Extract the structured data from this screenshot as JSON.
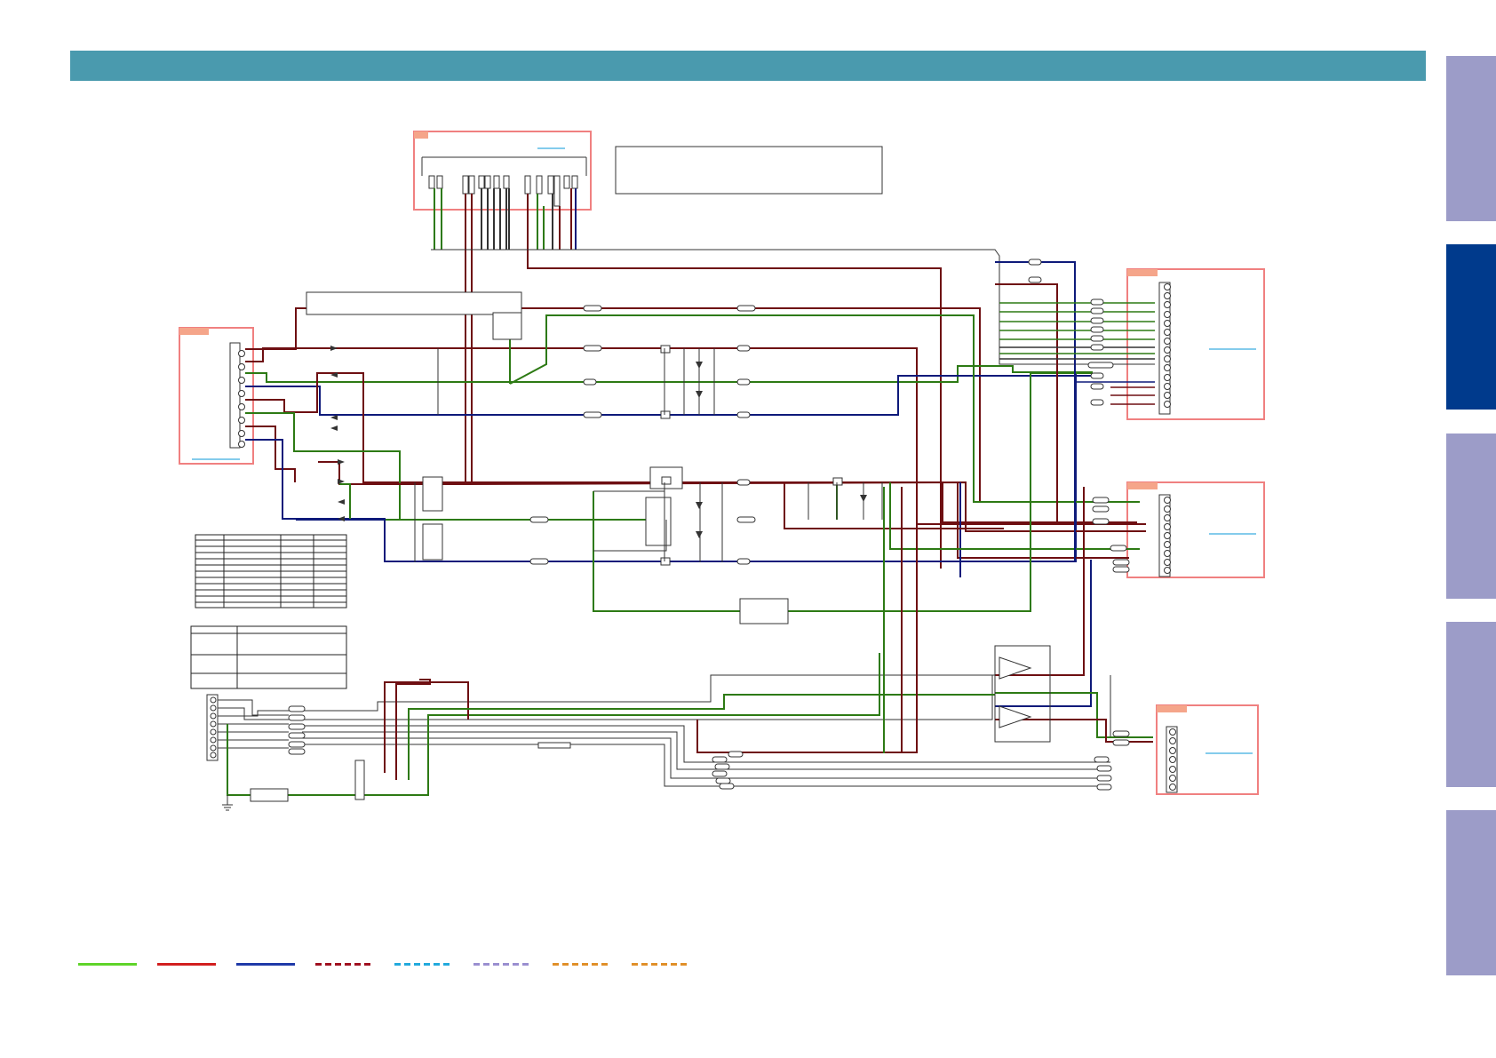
{
  "colors": {
    "header": "#4a9aae",
    "tab_inactive": "#9c9cc8",
    "tab_active": "#003a8c",
    "wire_green": "#2d7a14",
    "wire_red": "#6e0f12",
    "wire_blue": "#0e1a7a",
    "wire_gray": "#333333",
    "connector_box": "#f08080",
    "connector_tag": "#f5a58a",
    "link_underline": "#3aaee0",
    "legend_green": "#5fd42a",
    "legend_red": "#d21f1f",
    "legend_blue": "#1f3aa8",
    "legend_darkred_dash": "#a01020",
    "legend_cyan_dash": "#22aadd",
    "legend_violet_dash": "#9a8fd0",
    "legend_orange_dash": "#e0902a",
    "legend_orange2_dash": "#e0902a"
  },
  "side_tabs": [
    {
      "name": "tab-1",
      "active": false
    },
    {
      "name": "tab-2",
      "active": true
    },
    {
      "name": "tab-3",
      "active": false
    },
    {
      "name": "tab-4",
      "active": false
    },
    {
      "name": "tab-5",
      "active": false
    }
  ],
  "legend": [
    {
      "name": "legend-green-solid",
      "style": "solid",
      "color_key": "legend_green"
    },
    {
      "name": "legend-red-solid",
      "style": "solid",
      "color_key": "legend_red"
    },
    {
      "name": "legend-blue-solid",
      "style": "solid",
      "color_key": "legend_blue"
    },
    {
      "name": "legend-darkred-dashed",
      "style": "dashed",
      "color_key": "legend_darkred_dash"
    },
    {
      "name": "legend-cyan-dashed",
      "style": "dashed",
      "color_key": "legend_cyan_dash"
    },
    {
      "name": "legend-violet-dashed",
      "style": "dashed",
      "color_key": "legend_violet_dash"
    },
    {
      "name": "legend-orange-dashed",
      "style": "dashed",
      "color_key": "legend_orange_dash"
    },
    {
      "name": "legend-orange2-dashed",
      "style": "dashed",
      "color_key": "legend_orange2_dash"
    }
  ]
}
